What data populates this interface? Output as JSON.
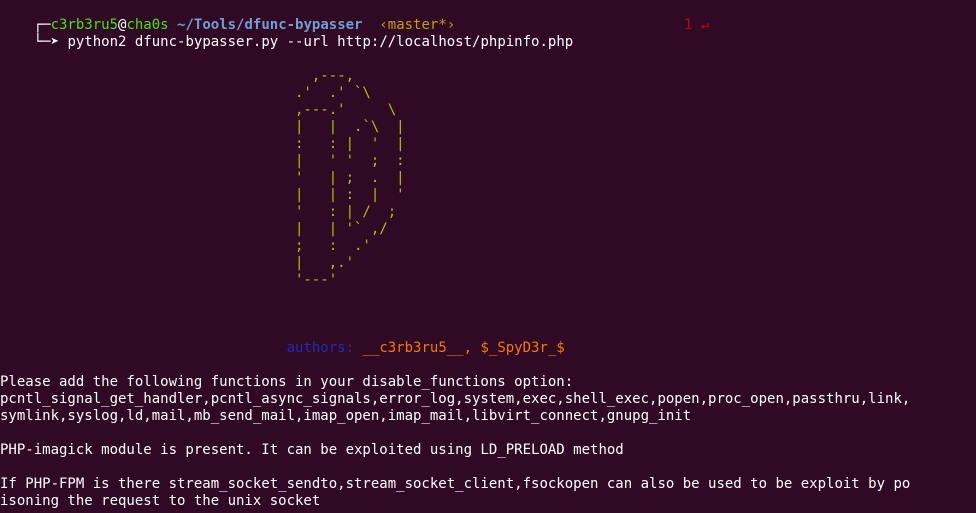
{
  "colors": {
    "background": "#300a24",
    "user_host": "#4ae20d",
    "path": "#729fcf",
    "git_branch": "#c4a000",
    "error": "#cc0000",
    "authors_label": "#1e2bb8",
    "authors_names": "#f57900",
    "ascii_art": "#b2c200"
  },
  "prompt": {
    "box_top": "┌─",
    "user": "c3rb3ru5",
    "at": "@",
    "host": "cha0s",
    "path": "~/Tools/dfunc-bypasser",
    "branch": "‹master*›",
    "box_bottom": "└─➤",
    "command": "python2 dfunc-bypasser.py --url http://localhost/phpinfo.php",
    "exit_code": "1 ↵"
  },
  "ascii_art": [
    "                                     ,---,",
    "                                   .'  .' `\\",
    "                                   ,---.'     \\",
    "                                   |   |  .`\\  |",
    "                                   :   : |  '  |",
    "                                   |   ' '  ;  :",
    "                                   '   | ;  .  |",
    "                                   |   | :  |  '",
    "                                   '   : | /  ;",
    "                                   |   | '` ,/",
    "                                   ;   :  .'",
    "                                   |   ,.'",
    "                                   '---'"
  ],
  "authors": {
    "label": "authors:",
    "names": "__c3rb3ru5__, $_SpyD3r_$"
  },
  "output": {
    "line1": "Please add the following functions in your disable_functions option:",
    "line2": "pcntl_signal_get_handler,pcntl_async_signals,error_log,system,exec,shell_exec,popen,proc_open,passthru,link,",
    "line3": "symlink,syslog,ld,mail,mb_send_mail,imap_open,imap_mail,libvirt_connect,gnupg_init",
    "line4": "PHP-imagick module is present. It can be exploited using LD_PRELOAD method",
    "line5": "If PHP-FPM is there stream_socket_sendto,stream_socket_client,fsockopen can also be used to be exploit by po",
    "line6": "isoning the request to the unix socket"
  }
}
